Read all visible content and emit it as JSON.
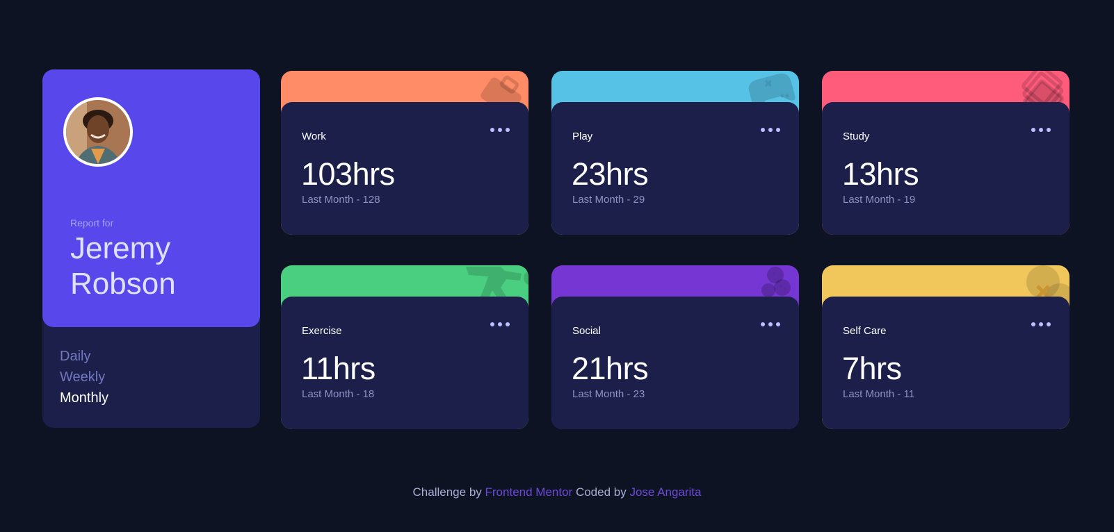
{
  "profile": {
    "report_for": "Report for",
    "name": "Jeremy Robson",
    "periods": [
      "Daily",
      "Weekly",
      "Monthly"
    ],
    "active_period": "Monthly"
  },
  "cards": [
    {
      "title": "Work",
      "hours": "103hrs",
      "previous": "Last Month - 128",
      "color": "#ff8c66",
      "icon": "briefcase-icon"
    },
    {
      "title": "Play",
      "hours": "23hrs",
      "previous": "Last Month - 29",
      "color": "#56c2e6",
      "icon": "gamepad-icon"
    },
    {
      "title": "Study",
      "hours": "13hrs",
      "previous": "Last Month - 19",
      "color": "#ff5c7c",
      "icon": "book-icon"
    },
    {
      "title": "Exercise",
      "hours": "11hrs",
      "previous": "Last Month - 18",
      "color": "#4acf81",
      "icon": "runner-icon"
    },
    {
      "title": "Social",
      "hours": "21hrs",
      "previous": "Last Month - 23",
      "color": "#7536d3",
      "icon": "social-icon"
    },
    {
      "title": "Self Care",
      "hours": "7hrs",
      "previous": "Last Month - 11",
      "color": "#f1c65b",
      "icon": "self-care-icon"
    }
  ],
  "footer": {
    "prefix": "Challenge by",
    "challenge_link": "Frontend Mentor",
    "middle": "Coded by",
    "author_link": "Jose Angarita",
    "link_color": "#6c4ad8"
  }
}
